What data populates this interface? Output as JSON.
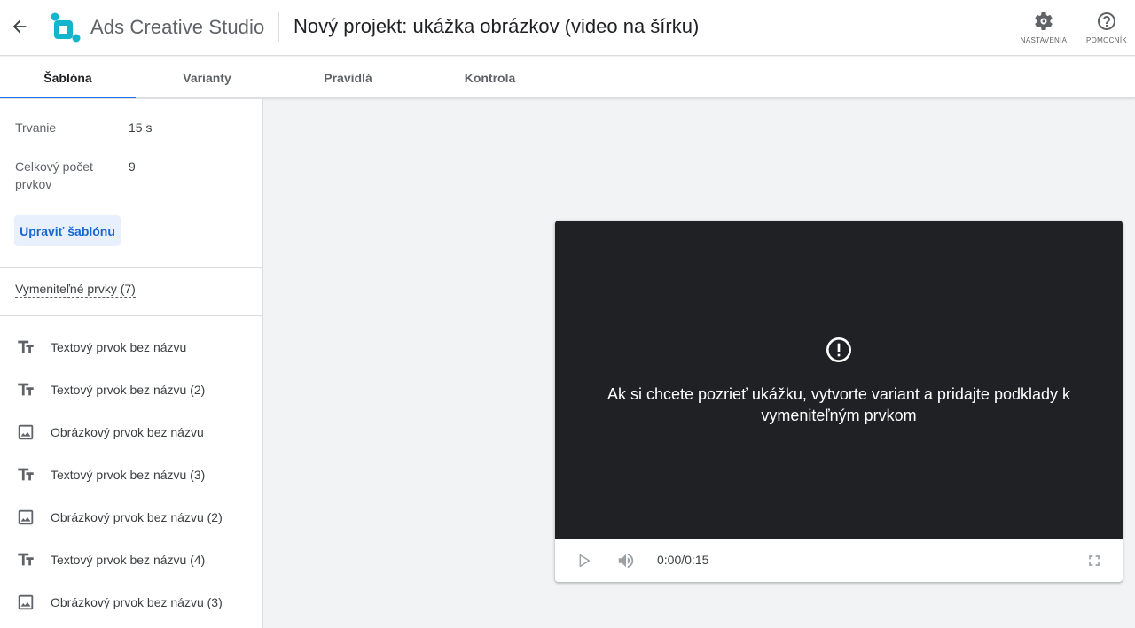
{
  "header": {
    "app_name": "Ads Creative Studio",
    "project_title": "Nový projekt: ukážka obrázkov (video na šírku)",
    "settings_label": "NASTAVENIA",
    "help_label": "POMOCNÍK"
  },
  "tabs": [
    {
      "label": "Šablóna",
      "active": true
    },
    {
      "label": "Varianty",
      "active": false
    },
    {
      "label": "Pravidlá",
      "active": false
    },
    {
      "label": "Kontrola",
      "active": false
    }
  ],
  "sidebar": {
    "duration_label": "Trvanie",
    "duration_value": "15 s",
    "total_elements_label": "Celkový počet prvkov",
    "total_elements_value": "9",
    "edit_template_button": "Upraviť šablónu",
    "replaceable_section": "Vymeniteľné prvky (7)",
    "elements": [
      {
        "label": "Textový prvok bez názvu",
        "icon": "text-field-icon"
      },
      {
        "label": "Textový prvok bez názvu (2)",
        "icon": "text-field-icon"
      },
      {
        "label": "Obrázkový prvok bez názvu",
        "icon": "image-icon"
      },
      {
        "label": "Textový prvok bez názvu (3)",
        "icon": "text-field-icon"
      },
      {
        "label": "Obrázkový prvok bez názvu (2)",
        "icon": "image-icon"
      },
      {
        "label": "Textový prvok bez názvu (4)",
        "icon": "text-field-icon"
      },
      {
        "label": "Obrázkový prvok bez názvu (3)",
        "icon": "image-icon"
      }
    ]
  },
  "player": {
    "message": "Ak si chcete pozrieť ukážku, vytvorte variant a pridajte podklady k vymeniteľným prvkom",
    "time": "0:00/0:15"
  },
  "colors": {
    "accent": "#1a73e8",
    "logo": "#12b5cb",
    "player_bg": "#202124"
  }
}
